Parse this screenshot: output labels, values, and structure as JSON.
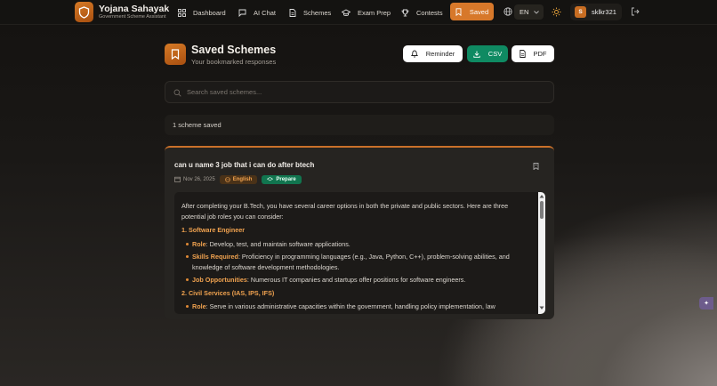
{
  "app": {
    "title": "Yojana Sahayak",
    "subtitle": "Government Scheme Assistant"
  },
  "nav": {
    "items": [
      {
        "label": "Dashboard",
        "icon": "grid-icon"
      },
      {
        "label": "AI Chat",
        "icon": "chat-icon"
      },
      {
        "label": "Schemes",
        "icon": "document-icon"
      },
      {
        "label": "Exam Prep",
        "icon": "graduation-cap-icon"
      },
      {
        "label": "Contests",
        "icon": "trophy-icon"
      }
    ],
    "active_label": "Saved",
    "language": "EN",
    "username": "sklkr321",
    "avatar_initial": "S"
  },
  "header": {
    "title": "Saved Schemes",
    "subtitle": "Your bookmarked responses",
    "reminder_label": "Reminder",
    "csv_label": "CSV",
    "pdf_label": "PDF"
  },
  "search": {
    "placeholder": "Search saved schemes...",
    "value": ""
  },
  "count_text": "1 scheme saved",
  "card": {
    "question": "can u name 3 job that i can do after btech",
    "date": "Nov 26, 2025",
    "language_tag": "English",
    "prepare_tag": "Prepare",
    "answer": {
      "intro": "After completing your B.Tech, you have several career options in both the private and public sectors. Here are three potential job roles you can consider:",
      "sections": [
        {
          "heading": "1. Software Engineer",
          "points": [
            {
              "key": "Role",
              "text": ": Develop, test, and maintain software applications."
            },
            {
              "key": "Skills Required",
              "text": ": Proficiency in programming languages (e.g., Java, Python, C++), problem-solving abilities, and knowledge of software development methodologies."
            },
            {
              "key": "Job Opportunities",
              "text": ": Numerous IT companies and startups offer positions for software engineers."
            }
          ]
        },
        {
          "heading": "2. Civil Services (IAS, IPS, IFS)",
          "points": [
            {
              "key": "Role",
              "text": ": Serve in various administrative capacities within the government, handling policy implementation, law enforcement, and foreign affairs."
            }
          ]
        }
      ]
    }
  },
  "colors": {
    "accent": "#d7782a",
    "green": "#0f8a62",
    "background": "#1a1816"
  }
}
